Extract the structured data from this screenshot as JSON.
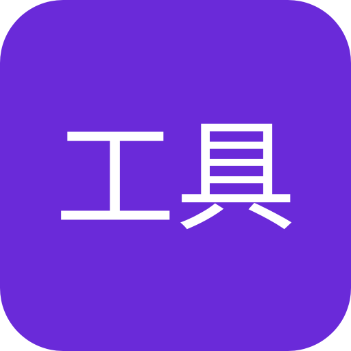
{
  "icon": {
    "label": "工具",
    "background_color": "#6a2ad9",
    "text_color": "#ffffff"
  }
}
